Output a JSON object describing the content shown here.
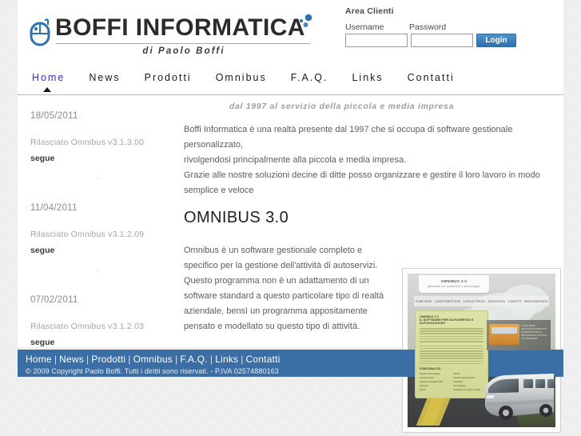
{
  "logo": {
    "wordmark": "BOFFI INFORMATICA",
    "subtitle": "di Paolo Boffi",
    "icon": "mouse-icon",
    "accent_color": "#2f72ad"
  },
  "login": {
    "title": "Area Clienti",
    "username_label": "Username",
    "password_label": "Password",
    "username_value": "",
    "password_value": "",
    "username_placeholder": "",
    "password_placeholder": "",
    "button_label": "Login"
  },
  "nav": {
    "items": [
      {
        "label": "Home",
        "active": true
      },
      {
        "label": "News",
        "active": false
      },
      {
        "label": "Prodotti",
        "active": false
      },
      {
        "label": "Omnibus",
        "active": false
      },
      {
        "label": "F.A.Q.",
        "active": false
      },
      {
        "label": "Links",
        "active": false
      },
      {
        "label": "Contatti",
        "active": false
      }
    ]
  },
  "sidebar": {
    "news": [
      {
        "date": "18/05/2011",
        "text": "Rilasciato Omnibus v3.1.3.00",
        "more": "segue"
      },
      {
        "date": "11/04/2011",
        "text": "Rilasciato Omnibus v3.1.2.09",
        "more": "segue"
      },
      {
        "date": "07/02/2011",
        "text": "Rilasciato Omnibus v3.1.2.03",
        "more": "segue"
      }
    ],
    "separator": "-"
  },
  "main": {
    "tagline": "dal 1997 al servizio della piccola e media impresa",
    "intro_lines": [
      "Boffi Informatica è una realtà presente dal 1997 che si occupa di software gestionale personalizzato,",
      "rivolgendosi principalmente alla piccola e media impresa.",
      "Grazie alle nostre soluzioni decine di ditte posso organizzare e gestire il loro lavoro in modo semplice e veloce"
    ],
    "promo_title": "OMNIBUS 3.0",
    "promo_text": "Omnibus è un software gestionale completo e specifico per la gestione dell'attività di autoservizi. Questo programma non è un adattamento di un software standard a questo particolare tipo di realtà aziendale, bensì un programma appositamente pensato e modellato su questo tipo di attività."
  },
  "brochure": {
    "card_title": "OMNIBUS 3.0",
    "card_subtitle": "gestionale per autoservizi e autonoleggio",
    "nav": [
      "HOME PAGE",
      "CARATTERISTICHE",
      "LISTINO PREZZI",
      "ASSISTENZA",
      "CONTATTI",
      "AREA RISERVATA"
    ],
    "panel_title_small": "OMNIBUS 3.0",
    "panel_title": "IL SOFTWARE PER AUTOSERVIZI E AUTONOLEGGIO",
    "features_heading": "FUNZIONALITA'",
    "features_left": [
      "Gestione autonoleggio",
      "Gestione autisti",
      "Anagrafica clienti/fornitori",
      "Preventivi",
      "Servizi"
    ],
    "features_right": [
      "Fatture",
      "Scadenzari/corrispettivi",
      "Statistiche",
      "Excel/stampe",
      "Statistiche per clienti e autisti"
    ],
    "photo_caption": "IL SOFTWARE GESTIONALE COMPLETO E SPECIFICO PER LA GESTIONE DELL'ATTIVITA' DI AUTOSERVIZI"
  },
  "footer": {
    "links": [
      "Home",
      "News",
      "Prodotti",
      "Omnibus",
      "F.A.Q.",
      "Links",
      "Contatti"
    ],
    "separator": "|",
    "copyright": "© 2009 Copyright Paolo Boffi. Tutti i diritti sono riservati. - P.IVA 02574880163",
    "background_color": "#3b6ea5"
  }
}
